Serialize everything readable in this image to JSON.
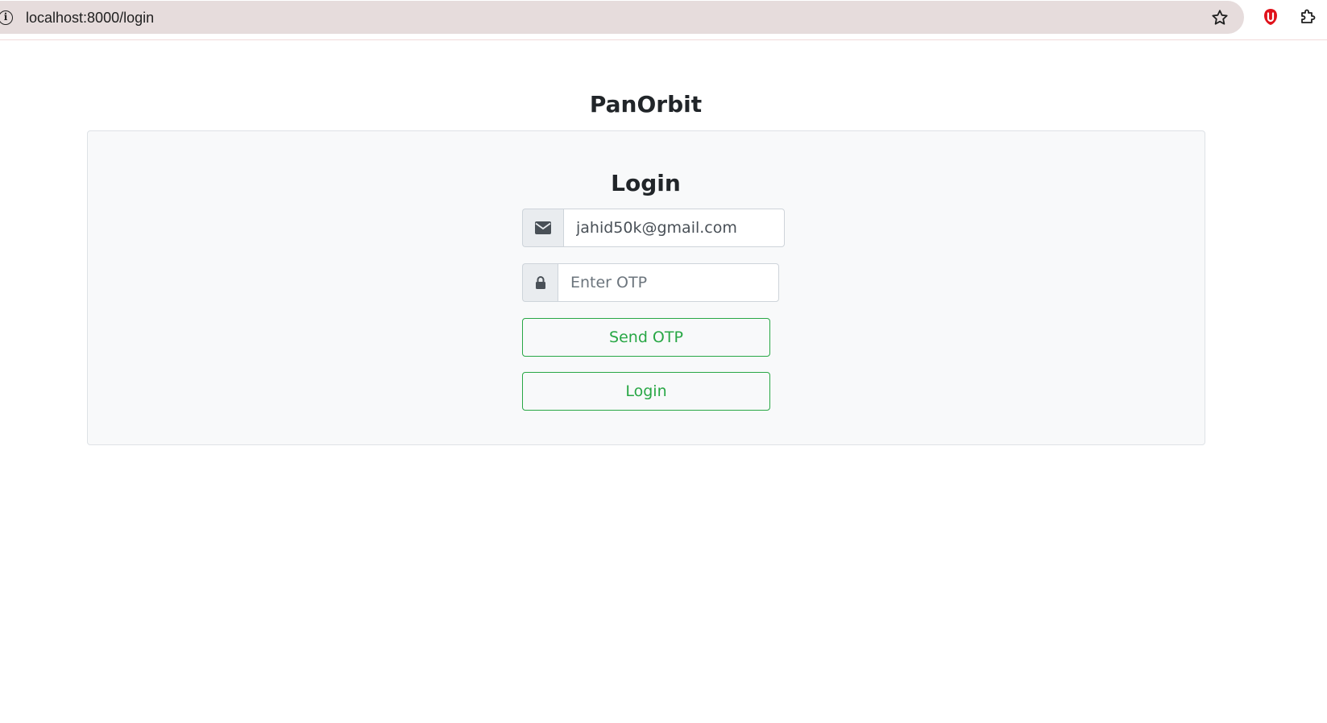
{
  "browser": {
    "url": "localhost:8000/login",
    "info_icon": "info-icon",
    "bookmark_icon": "star-icon",
    "extension_icons": [
      "shield-extension-icon",
      "puzzle-extensions-icon"
    ]
  },
  "brand": {
    "name": "PanOrbit"
  },
  "login_card": {
    "title": "Login",
    "email": {
      "icon": "envelope-icon",
      "value": "jahid50k@gmail.com"
    },
    "otp": {
      "icon": "lock-icon",
      "placeholder": "Enter OTP",
      "value": ""
    },
    "send_otp_label": "Send OTP",
    "login_label": "Login"
  },
  "colors": {
    "accent_green": "#28a745",
    "card_background": "#f8f9fa",
    "addon_background": "#e9ecef",
    "text_dark": "#212529",
    "browser_bar": "#e6dcdc"
  }
}
